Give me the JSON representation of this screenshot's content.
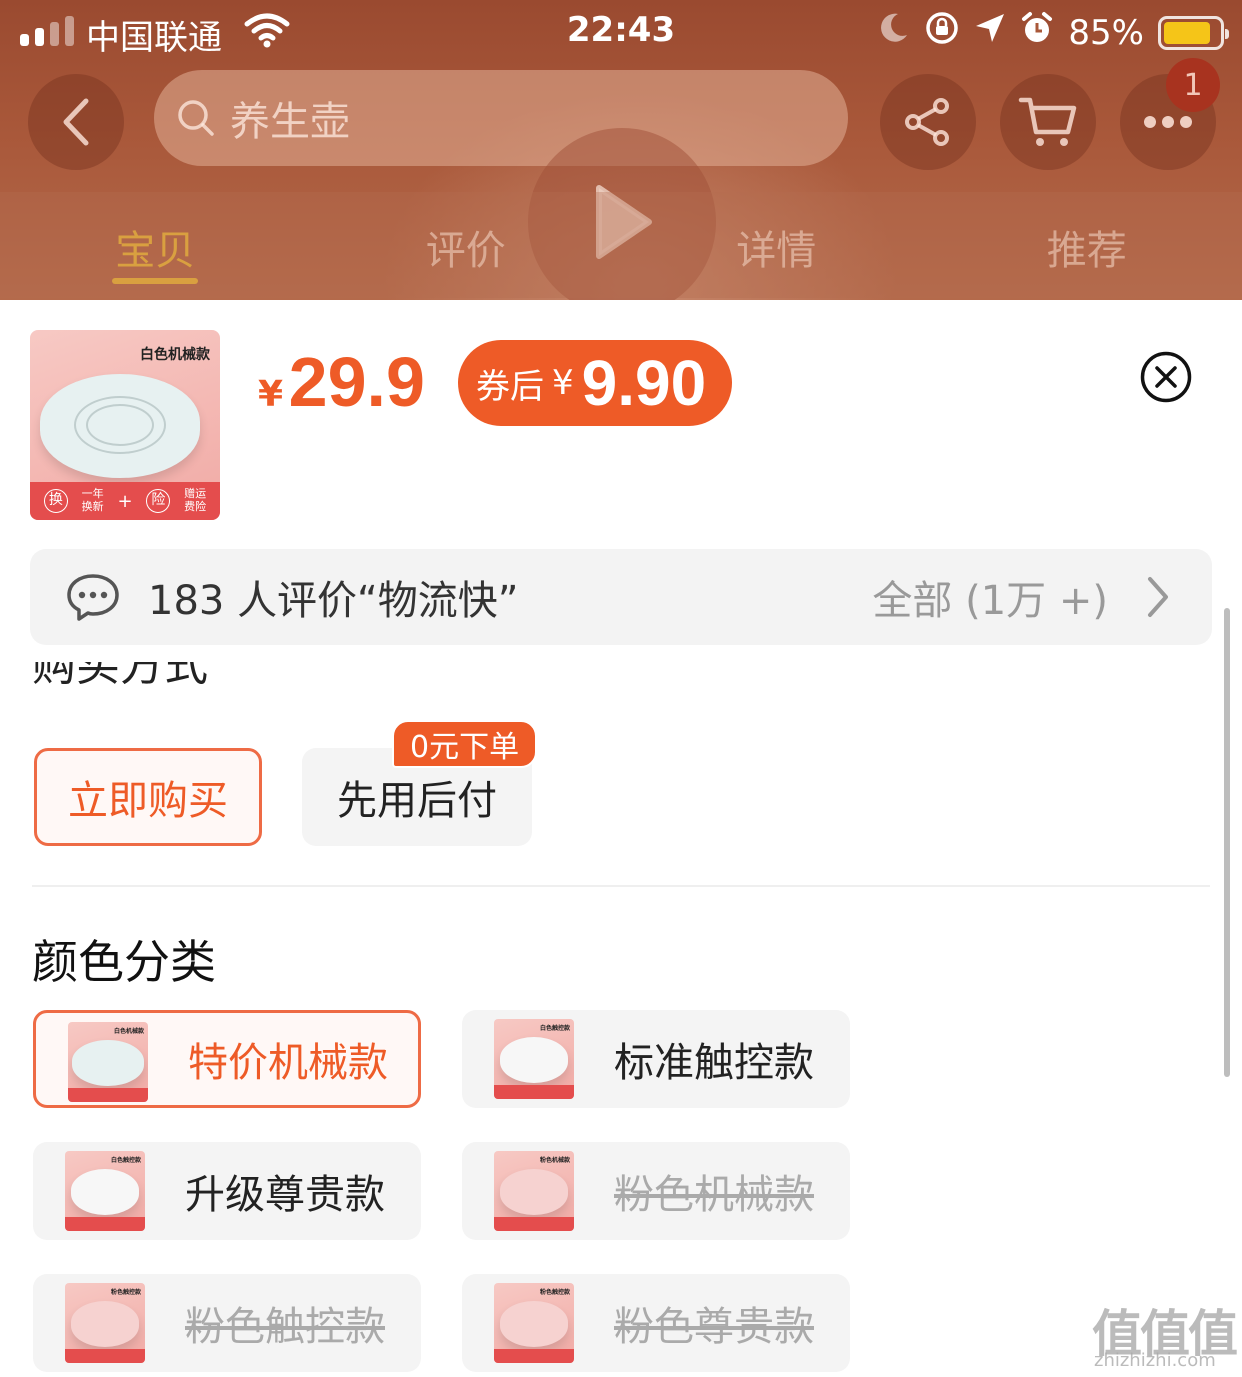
{
  "status_bar": {
    "carrier": "中国联通",
    "time": "22:43",
    "battery_percent": "85%",
    "battery_level": 0.85,
    "icons": [
      "signal-icon",
      "wifi-icon",
      "moon-icon",
      "rotation-lock-icon",
      "location-icon",
      "alarm-icon",
      "battery-icon"
    ]
  },
  "header": {
    "search_placeholder": "养生壶",
    "more_badge": "1",
    "tabs": [
      {
        "label": "宝贝",
        "active": true
      },
      {
        "label": "评价",
        "active": false
      },
      {
        "label": "详情",
        "active": false
      },
      {
        "label": "推荐",
        "active": false
      }
    ]
  },
  "sku_sheet": {
    "thumb_label": "白色机械款",
    "thumb_strip": {
      "badge1": "换",
      "text1_a": "一年",
      "text1_b": "换新",
      "plus": "+",
      "badge2": "险",
      "text2_a": "赠运",
      "text2_b": "费险"
    },
    "price": {
      "currency": "¥",
      "value": "29.9"
    },
    "coupon": {
      "label": "券后",
      "currency": "¥",
      "value": "9.90"
    },
    "review": {
      "text": "183 人评价“物流快”",
      "all_label": "全部 (1万 +)"
    },
    "purchase_section_title": "购买方式",
    "purchase_options": {
      "buy_now": "立即购买",
      "pay_later": "先用后付",
      "pay_later_tag": "0元下单"
    },
    "color_section_title": "颜色分类",
    "color_options": [
      {
        "label": "特价机械款",
        "thumb_label": "白色机械款",
        "state": "selected"
      },
      {
        "label": "标准触控款",
        "thumb_label": "白色触控款",
        "state": "available"
      },
      {
        "label": "升级尊贵款",
        "thumb_label": "白色触控款",
        "state": "available"
      },
      {
        "label": "粉色机械款",
        "thumb_label": "粉色机械款",
        "state": "disabled"
      },
      {
        "label": "粉色触控款",
        "thumb_label": "粉色触控款",
        "state": "disabled"
      },
      {
        "label": "粉色尊贵款",
        "thumb_label": "粉色触控款",
        "state": "disabled"
      }
    ]
  },
  "watermark": {
    "glyphs": "值值值",
    "site": "zhizhizhi.com"
  },
  "colors": {
    "accent": "#ee5b27",
    "selected_border": "#ee6b45",
    "option_bg": "#f4f4f4",
    "disabled_text": "#aaaaaa",
    "tab_active": "#d9a040"
  }
}
